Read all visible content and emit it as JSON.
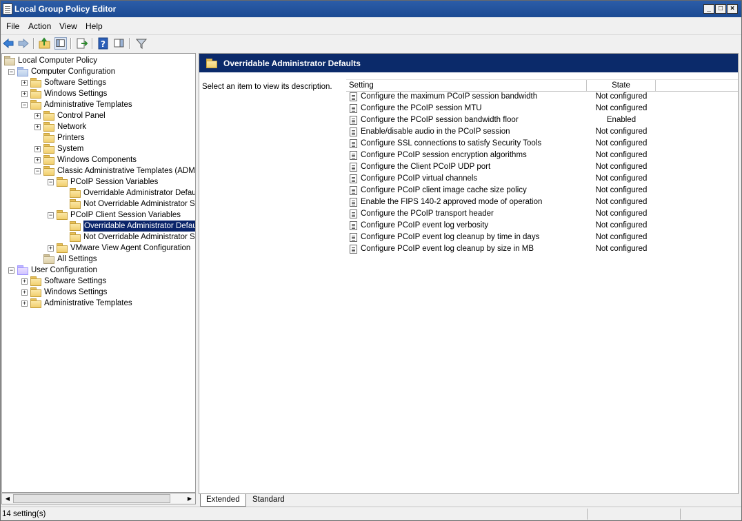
{
  "window": {
    "title": "Local Group Policy Editor",
    "controls": [
      "_",
      "□",
      "×"
    ]
  },
  "menu": [
    "File",
    "Action",
    "View",
    "Help"
  ],
  "toolbar": [
    "back-icon",
    "forward-icon",
    "up-folder-icon",
    "show-hide-tree-icon",
    "export-list-icon",
    "help-icon",
    "show-hide-action-pane-icon",
    "filter-icon"
  ],
  "tree": [
    {
      "label": "Local Computer Policy",
      "level": 0,
      "expander": "",
      "icon": "policy-icon"
    },
    {
      "label": "Computer Configuration",
      "level": 1,
      "expander": "−",
      "icon": "computer-icon"
    },
    {
      "label": "Software Settings",
      "level": 2,
      "expander": "+",
      "icon": "folder-icon"
    },
    {
      "label": "Windows Settings",
      "level": 2,
      "expander": "+",
      "icon": "folder-icon"
    },
    {
      "label": "Administrative Templates",
      "level": 2,
      "expander": "−",
      "icon": "folder-icon"
    },
    {
      "label": "Control Panel",
      "level": 3,
      "expander": "+",
      "icon": "folder-icon"
    },
    {
      "label": "Network",
      "level": 3,
      "expander": "+",
      "icon": "folder-icon"
    },
    {
      "label": "Printers",
      "level": 3,
      "expander": "",
      "icon": "folder-icon"
    },
    {
      "label": "System",
      "level": 3,
      "expander": "+",
      "icon": "folder-icon"
    },
    {
      "label": "Windows Components",
      "level": 3,
      "expander": "+",
      "icon": "folder-icon"
    },
    {
      "label": "Classic Administrative Templates (ADM)",
      "level": 3,
      "expander": "−",
      "icon": "folder-icon"
    },
    {
      "label": "PCoIP Session Variables",
      "level": 4,
      "expander": "−",
      "icon": "folder-icon"
    },
    {
      "label": "Overridable Administrator Defaults",
      "level": 5,
      "expander": "",
      "icon": "folder-icon"
    },
    {
      "label": "Not Overridable Administrator Settings",
      "level": 5,
      "expander": "",
      "icon": "folder-icon"
    },
    {
      "label": "PCoIP Client Session Variables",
      "level": 4,
      "expander": "−",
      "icon": "folder-icon"
    },
    {
      "label": "Overridable Administrator Defaults",
      "level": 5,
      "expander": "",
      "icon": "folder-icon",
      "selected": true
    },
    {
      "label": "Not Overridable Administrator Settings",
      "level": 5,
      "expander": "",
      "icon": "folder-icon"
    },
    {
      "label": "VMware View Agent Configuration",
      "level": 4,
      "expander": "+",
      "icon": "folder-icon"
    },
    {
      "label": "All Settings",
      "level": 3,
      "expander": "",
      "icon": "all-settings-icon"
    },
    {
      "label": "User Configuration",
      "level": 1,
      "expander": "−",
      "icon": "user-icon"
    },
    {
      "label": "Software Settings",
      "level": 2,
      "expander": "+",
      "icon": "folder-icon"
    },
    {
      "label": "Windows Settings",
      "level": 2,
      "expander": "+",
      "icon": "folder-icon"
    },
    {
      "label": "Administrative Templates",
      "level": 2,
      "expander": "+",
      "icon": "folder-icon"
    }
  ],
  "details": {
    "header": "Overridable Administrator Defaults",
    "description": "Select an item to view its description.",
    "columns": {
      "setting": "Setting",
      "state": "State"
    },
    "rows": [
      {
        "setting": "Configure the maximum PCoIP session bandwidth",
        "state": "Not configured"
      },
      {
        "setting": "Configure the PCoIP session MTU",
        "state": "Not configured"
      },
      {
        "setting": "Configure the PCoIP session bandwidth floor",
        "state": "Enabled"
      },
      {
        "setting": "Enable/disable audio in the PCoIP session",
        "state": "Not configured"
      },
      {
        "setting": "Configure SSL connections to satisfy Security Tools",
        "state": "Not configured"
      },
      {
        "setting": "Configure PCoIP session encryption algorithms",
        "state": "Not configured"
      },
      {
        "setting": "Configure the Client PCoIP UDP port",
        "state": "Not configured"
      },
      {
        "setting": "Configure PCoIP virtual channels",
        "state": "Not configured"
      },
      {
        "setting": "Configure PCoIP client image cache size policy",
        "state": "Not configured"
      },
      {
        "setting": "Enable the FIPS 140-2 approved mode of operation",
        "state": "Not configured"
      },
      {
        "setting": "Configure the PCoIP transport header",
        "state": "Not configured"
      },
      {
        "setting": "Configure PCoIP event log verbosity",
        "state": "Not configured"
      },
      {
        "setting": "Configure PCoIP event log cleanup by time in days",
        "state": "Not configured"
      },
      {
        "setting": "Configure PCoIP event log cleanup by size in MB",
        "state": "Not configured"
      }
    ]
  },
  "tabs": [
    "Extended",
    "Standard"
  ],
  "status": "14 setting(s)"
}
